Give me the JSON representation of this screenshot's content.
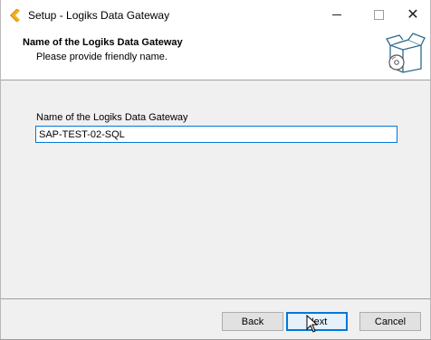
{
  "window": {
    "title": "Setup - Logiks Data Gateway",
    "controls": {
      "minimize": "minimize-icon",
      "maximize": "maximize-icon",
      "close": "close-icon"
    }
  },
  "header": {
    "title": "Name of the Logiks Data Gateway",
    "subtitle": "Please provide friendly name."
  },
  "form": {
    "label": "Name of the Logiks Data Gateway",
    "value": "SAP-TEST-02-SQL"
  },
  "buttons": {
    "back": "Back",
    "next": "Next",
    "cancel": "Cancel"
  },
  "colors": {
    "accent": "#0078d7",
    "window_bg": "#f0f0f0",
    "header_bg": "#ffffff"
  }
}
